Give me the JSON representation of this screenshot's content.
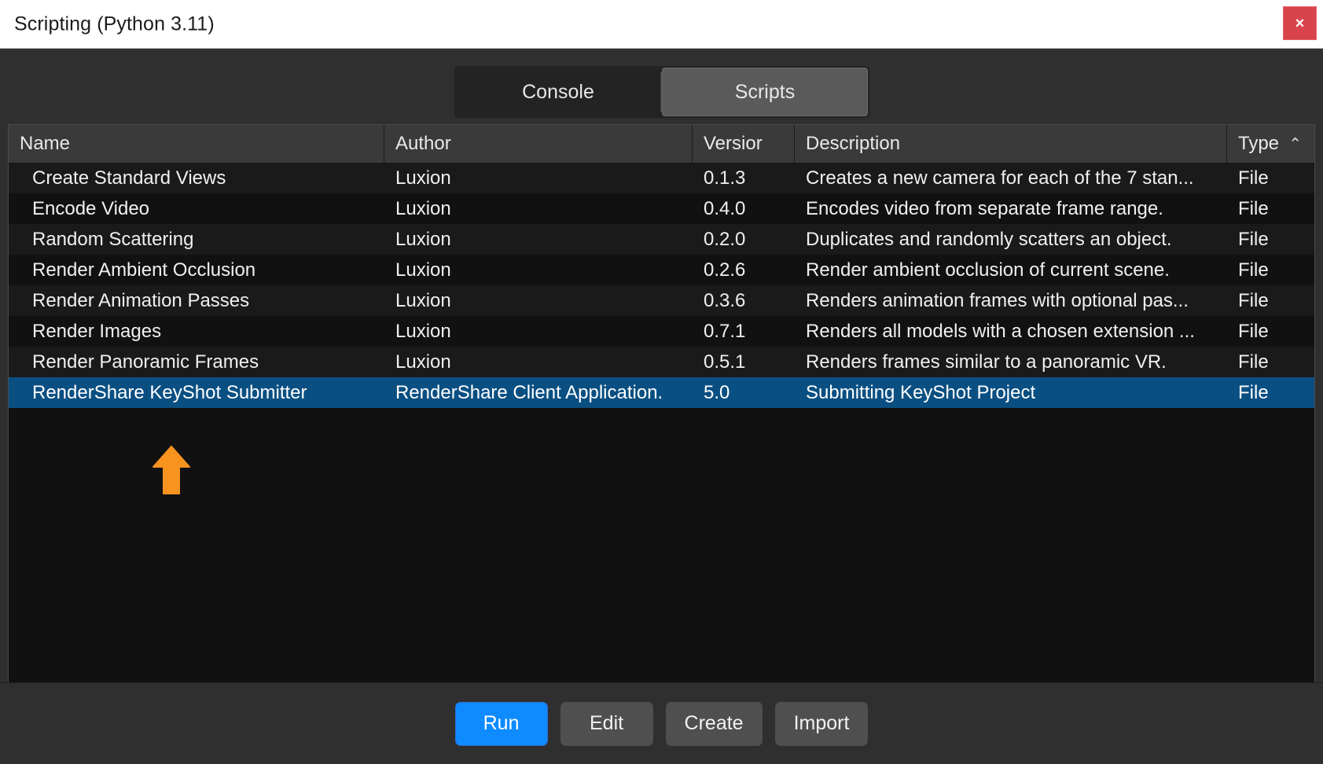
{
  "window": {
    "title": "Scripting (Python 3.11)",
    "close_label": "×",
    "close_icon": "close-icon",
    "close_color": "#d9434c"
  },
  "tabs": [
    {
      "label": "Console",
      "active": false
    },
    {
      "label": "Scripts",
      "active": true
    }
  ],
  "table": {
    "columns": [
      {
        "key": "name",
        "label": "Name"
      },
      {
        "key": "author",
        "label": "Author"
      },
      {
        "key": "version",
        "label": "Versior"
      },
      {
        "key": "description",
        "label": "Description"
      },
      {
        "key": "type",
        "label": "Type"
      }
    ],
    "sort_indicator": "⌃",
    "rows": [
      {
        "name": "Create Standard Views",
        "author": "Luxion",
        "version": "0.1.3",
        "description": "Creates a new camera for each of the 7 stan...",
        "type": "File",
        "selected": false
      },
      {
        "name": "Encode Video",
        "author": "Luxion",
        "version": "0.4.0",
        "description": "Encodes video from separate frame range.",
        "type": "File",
        "selected": false
      },
      {
        "name": "Random Scattering",
        "author": "Luxion",
        "version": "0.2.0",
        "description": "Duplicates and randomly scatters an object.",
        "type": "File",
        "selected": false
      },
      {
        "name": "Render Ambient Occlusion",
        "author": "Luxion",
        "version": "0.2.6",
        "description": "Render ambient occlusion of current scene.",
        "type": "File",
        "selected": false
      },
      {
        "name": "Render Animation Passes",
        "author": "Luxion",
        "version": "0.3.6",
        "description": "Renders animation frames with optional pas...",
        "type": "File",
        "selected": false
      },
      {
        "name": "Render Images",
        "author": "Luxion",
        "version": "0.7.1",
        "description": "Renders all models with a chosen extension ...",
        "type": "File",
        "selected": false
      },
      {
        "name": "Render Panoramic Frames",
        "author": "Luxion",
        "version": "0.5.1",
        "description": "Renders frames similar to a panoramic VR.",
        "type": "File",
        "selected": false
      },
      {
        "name": "RenderShare KeyShot Submitter",
        "author": "RenderShare Client Application.",
        "version": "5.0",
        "description": "Submitting KeyShot Project",
        "type": "File",
        "selected": true
      }
    ]
  },
  "footer": {
    "buttons": [
      {
        "label": "Run",
        "primary": true
      },
      {
        "label": "Edit",
        "primary": false
      },
      {
        "label": "Create",
        "primary": false
      },
      {
        "label": "Import",
        "primary": false
      }
    ]
  },
  "annotation": {
    "arrow_icon": "up-arrow-icon",
    "color": "#f7931e"
  },
  "colors": {
    "selection_blue": "#0a4f82",
    "accent_blue": "#0d8bff",
    "panel_background": "#2f2f2f",
    "table_background": "#111111",
    "header_background": "#3a3a3a"
  }
}
